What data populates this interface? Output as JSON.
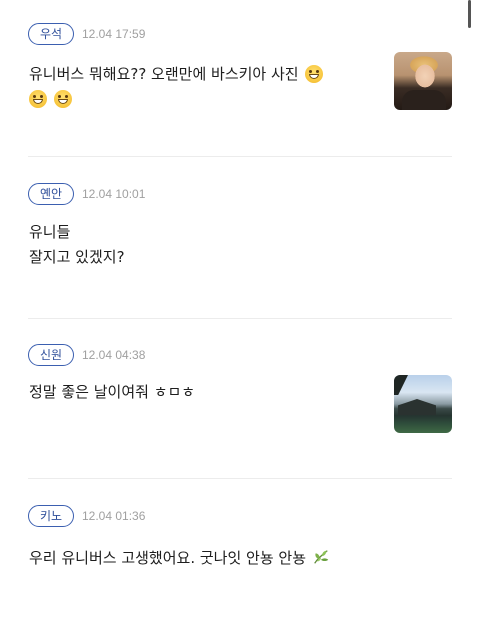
{
  "posts": [
    {
      "author": "우석",
      "time": "12.04 17:59",
      "lines": [
        "유니버스 뭐해요?? 오랜만에 바스키아 사진"
      ],
      "trailing_emoji": "grinning-face-icon",
      "extra_emoji_count": 2,
      "thumbnail": "portrait-photo"
    },
    {
      "author": "옌안",
      "time": "12.04 10:01",
      "lines": [
        "유니들",
        "잘지고 있겠지?"
      ]
    },
    {
      "author": "신원",
      "time": "12.04 04:38",
      "lines": [
        "정말 좋은 날이여줘 ㅎㅁㅎ"
      ],
      "thumbnail": "landscape-photo"
    },
    {
      "author": "키노",
      "time": "12.04 01:36",
      "lines": [
        "우리 유니버스 고생했어요. 굿나잇 안뇽 안뇽"
      ],
      "trailing_emoji": "herb-leaf-icon"
    }
  ],
  "colors": {
    "badge_border": "#3b5fb0",
    "badge_text": "#2f4f9a",
    "timestamp": "#a0a0a0",
    "divider": "#ececec"
  }
}
